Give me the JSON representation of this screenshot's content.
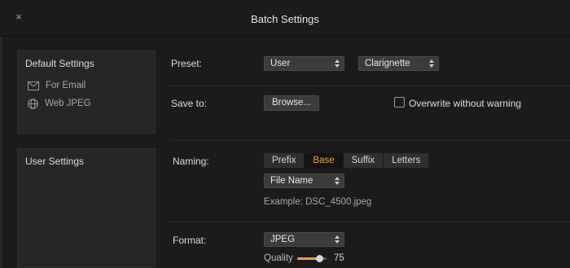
{
  "window": {
    "title": "Batch Settings",
    "close_glyph": "×"
  },
  "sidebar": {
    "default_heading": "Default Settings",
    "default_items": [
      {
        "label": "For Email",
        "icon": "envelope-icon"
      },
      {
        "label": "Web JPEG",
        "icon": "globe-icon"
      }
    ],
    "user_heading": "User Settings"
  },
  "preset": {
    "label": "Preset:",
    "type_value": "User",
    "name_value": "Clarignette"
  },
  "save": {
    "label": "Save to:",
    "browse_label": "Browse...",
    "overwrite_label": "Overwrite without warning",
    "overwrite_checked": false
  },
  "naming": {
    "label": "Naming:",
    "tabs": [
      "Prefix",
      "Base",
      "Suffix",
      "Letters"
    ],
    "active_tab": "Base",
    "field_value": "File Name",
    "example": "Example: DSC_4500.jpeg"
  },
  "format": {
    "label": "Format:",
    "value": "JPEG",
    "quality_label": "Quality",
    "quality_value": "75",
    "quality_percent": 75
  },
  "colors": {
    "background": "#1b1b1b",
    "panel": "#262626",
    "accent": "#e8a243"
  }
}
